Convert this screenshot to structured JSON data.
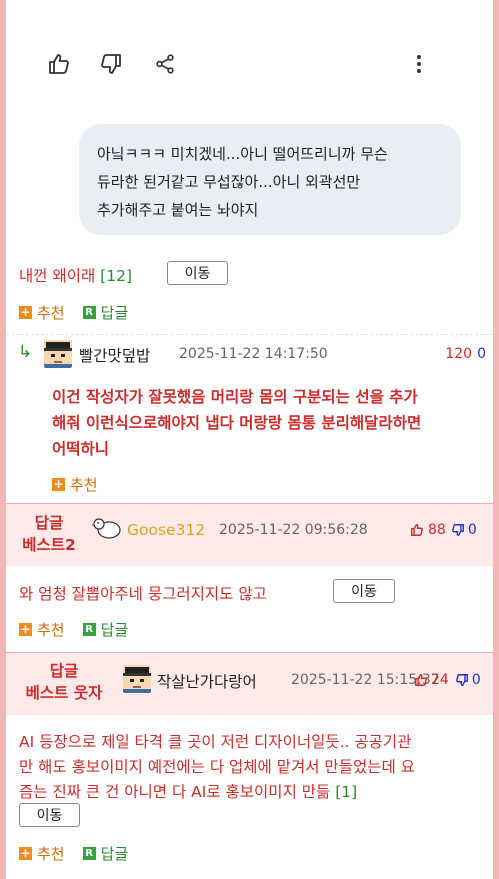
{
  "toolbar": {
    "like_icon": "thumbs-up-icon",
    "dislike_icon": "thumbs-down-icon",
    "share_icon": "share-icon",
    "more_icon": "more-vert-icon"
  },
  "bubble": {
    "lines": [
      "아닠ㅋㅋㅋ 미치겠네...아니 떨어뜨리니까 무슨",
      "듀라한 된거같고 무섭잖아...아니 외곽선만",
      "추가해주고 붙여는 놔야지"
    ]
  },
  "comment1": {
    "text": "내껀 왜이래",
    "count": "[12]",
    "move_label": "이동",
    "recommend_label": "추천",
    "reply_label": "답글"
  },
  "reply1": {
    "arrow": "↳",
    "nickname": "빨간맛덮밥",
    "date": "2025-11-22 14:17:50",
    "score_up": "120",
    "score_down": "0",
    "lines": [
      "이건 작성자가 잘못했음 머리랑 몸의 구분되는 선을 추가",
      "해줘 이런식으로해야지 냅다 머랑랑 몸통 분리해달라하면",
      "어떡하니"
    ],
    "recommend_label": "추천"
  },
  "best2": {
    "label_line1": "답글",
    "label_line2": "베스트2",
    "nickname": "Goose312",
    "date": "2025-11-22 09:56:28",
    "up": "88",
    "down": "0",
    "text": "와 엄청 잘뽑아주네 뭉그러지지도 않고",
    "move_label": "이동",
    "recommend_label": "추천",
    "reply_label": "답글"
  },
  "best3": {
    "label_line1": "답글",
    "label_line2": "베스트 웃자",
    "nickname": "작살난가다랑어",
    "date": "2025-11-22 15:15:37",
    "up": "24",
    "down": "0",
    "lines": [
      "AI 등장으로 제일 타격 클 곳이 저런 디자이너일듯.. 공공기관",
      "만 해도 홍보이미지 예전에는 다 업체에 맡겨서 만들었는데 요",
      "즘는 진짜 큰 건 아니면 다 AI로 홍보이미지 만듦"
    ],
    "count": "[1]",
    "move_label": "이동",
    "recommend_label": "추천",
    "reply_label": "답글"
  },
  "colors": {
    "accent_red": "#d22b2b",
    "count_green": "#2a8a2a",
    "nick_gold": "#d9a521",
    "frame_pink": "#f3b6b6",
    "band_pink": "#ffeaea"
  }
}
